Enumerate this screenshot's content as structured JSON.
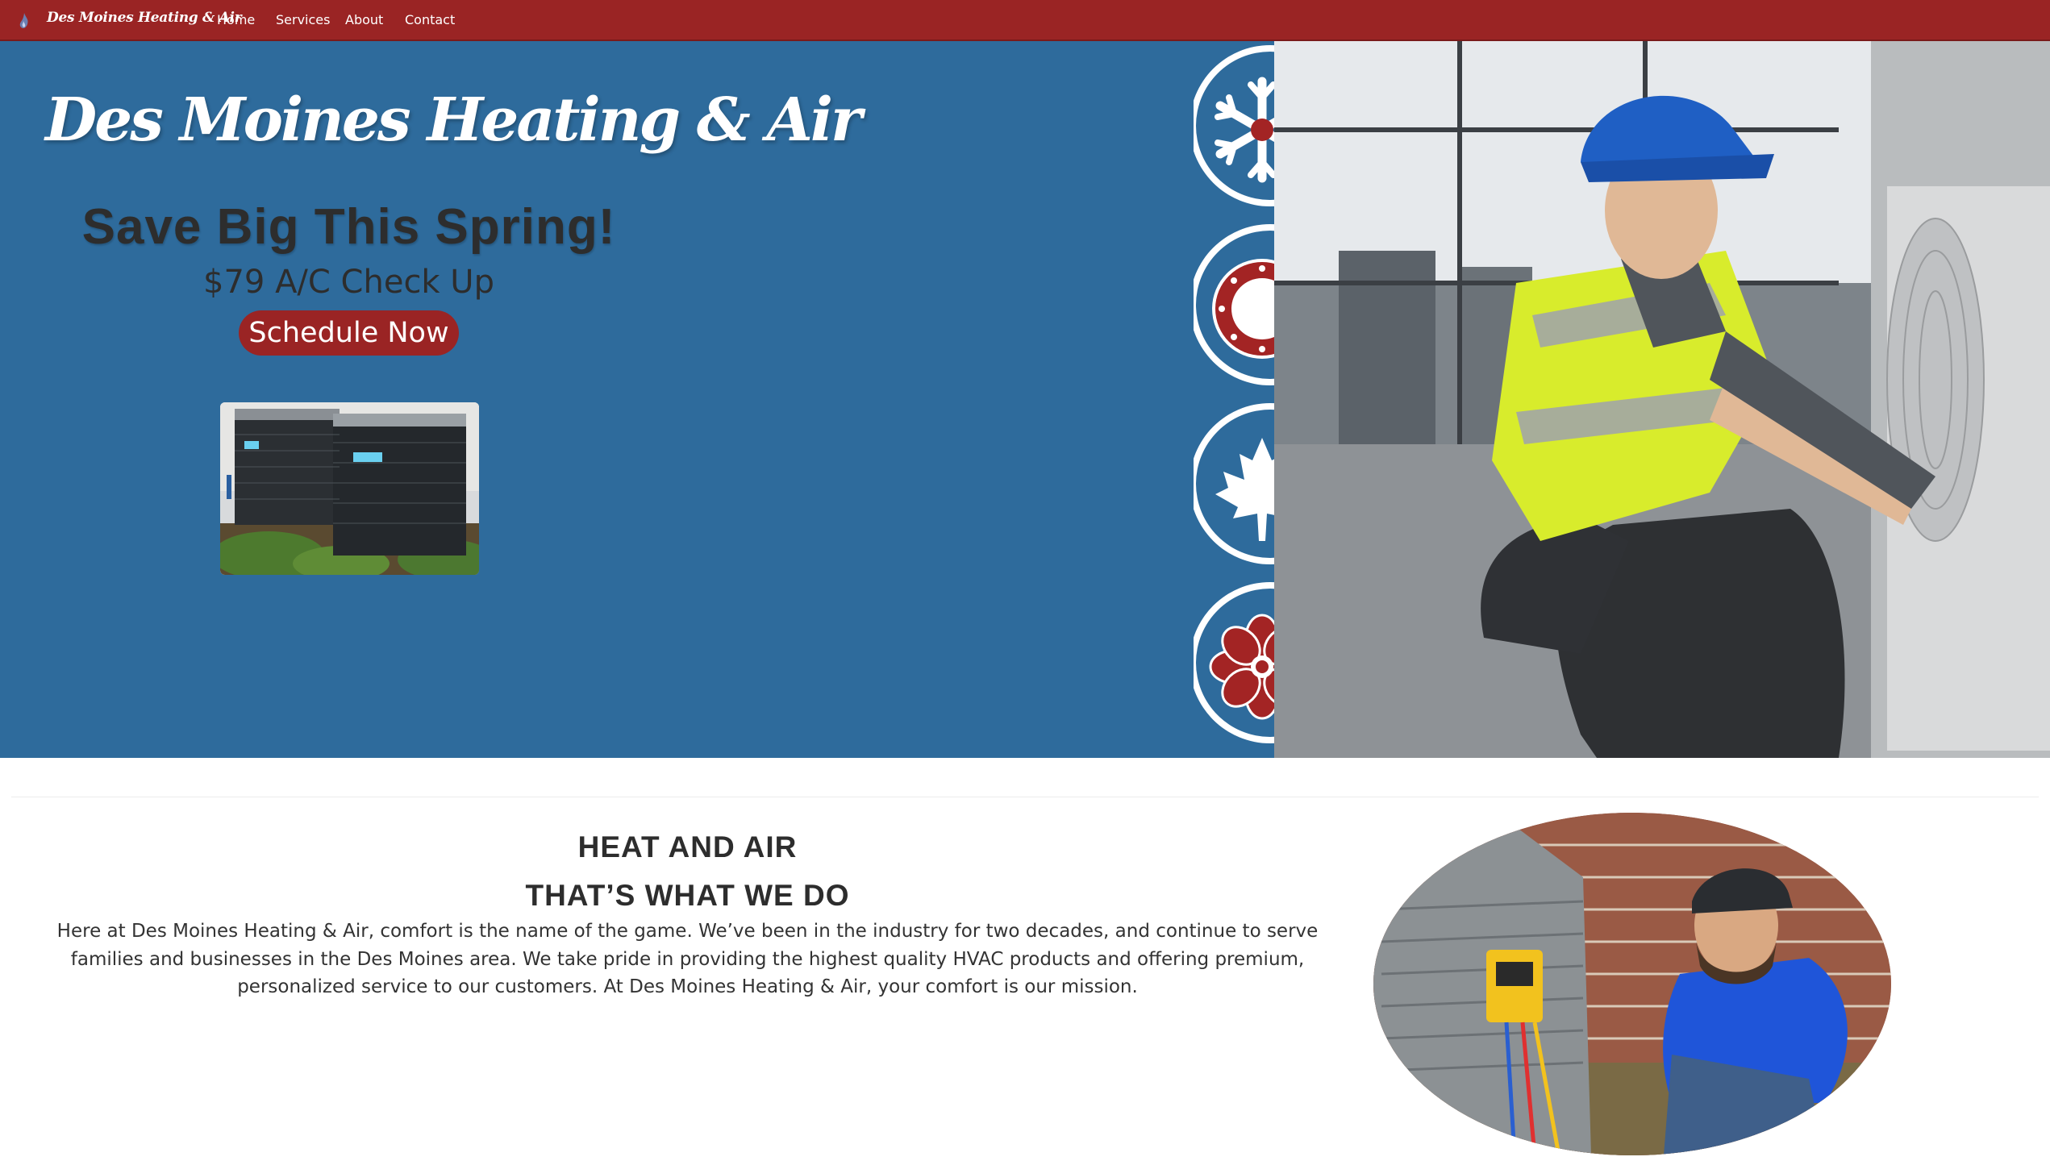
{
  "navbar": {
    "brand": "Des Moines Heating & Air",
    "links": [
      "Home",
      "Services",
      "About",
      "Contact"
    ],
    "background": "#9a2424"
  },
  "hero": {
    "brand": "Des Moines Heating & Air",
    "headline": "Save Big This Spring!",
    "offer": "$79 A/C Check Up",
    "cta_label": "Schedule Now",
    "background": "#2e6b9c",
    "accent": "#9a2424"
  },
  "about": {
    "heading_line1": "HEAT AND AIR",
    "heading_line2": "THAT’S WHAT WE DO",
    "body": "Here at Des Moines Heating & Air, comfort is the name of the game. We’ve been in the industry for two decades, and continue to serve families and businesses in the Des Moines area. We take pride in providing the highest quality HVAC products and offering premium, personalized service to our customers. At Des Moines Heating & Air, your comfort is our mission."
  },
  "icons": [
    "flame-logo-icon",
    "snowflake-icon",
    "sun-icon",
    "maple-leaf-icon",
    "flower-icon"
  ]
}
